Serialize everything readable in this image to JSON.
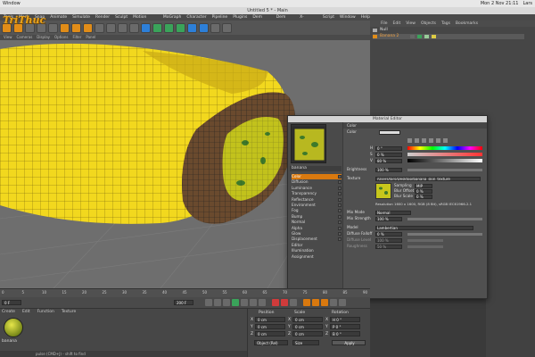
{
  "macbar": {
    "app": "Window",
    "clock": "Mon 2 Nov 21:11",
    "user": "Lars"
  },
  "window_title": "Untitled 5 * - Main",
  "menu": [
    "Tools",
    "Mesh",
    "Snap",
    "Animate",
    "Simulate",
    "Render",
    "Sculpt",
    "Motion Tracker",
    "MoGraph",
    "Character",
    "Pipeline",
    "Plugins",
    "Dem Earth",
    "Dem Earth",
    "X-Particles",
    "Script",
    "Window",
    "Help"
  ],
  "view_menu": [
    "View",
    "Cameras",
    "Display",
    "Options",
    "Filter",
    "Panel"
  ],
  "watermark": "TriThuc",
  "objects": {
    "menu": [
      "File",
      "Edit",
      "View",
      "Objects",
      "Tags",
      "Bookmarks"
    ],
    "rows": [
      {
        "name": "Null"
      },
      {
        "name": "Banana 2"
      }
    ]
  },
  "material_editor": {
    "title": "Material Editor",
    "material_name": "banana",
    "channels": [
      {
        "label": "Color",
        "selected": true
      },
      {
        "label": "Diffusion"
      },
      {
        "label": "Luminance"
      },
      {
        "label": "Transparency"
      },
      {
        "label": "Reflectance"
      },
      {
        "label": "Environment"
      },
      {
        "label": "Fog"
      },
      {
        "label": "Bump"
      },
      {
        "label": "Normal"
      },
      {
        "label": "Alpha"
      },
      {
        "label": "Glow"
      },
      {
        "label": "Displacement"
      },
      {
        "label": "Editor"
      },
      {
        "label": "Illumination"
      },
      {
        "label": "Assignment"
      }
    ],
    "section": "Color",
    "color_label": "Color",
    "h_label": "H",
    "h_value": "0 °",
    "s_label": "S",
    "s_value": "0 %",
    "v_label": "V",
    "v_value": "80 %",
    "brightness_label": "Brightness",
    "brightness_value": "100 %",
    "texture_label": "Texture",
    "texture_path": "/Users/lars/Desktop/banana_skin_texture",
    "sampling_label": "Sampling",
    "sampling_value": "MIP",
    "blur_offset_label": "Blur Offset",
    "blur_offset_value": "0 %",
    "blur_scale_label": "Blur Scale",
    "blur_scale_value": "0 %",
    "resolution": "Resolution 1600 x 1600, RGB (8 Bit), sRGB IEC61966-2.1",
    "mix_mode_label": "Mix Mode",
    "mix_mode_value": "Normal",
    "mix_strength_label": "Mix Strength",
    "mix_strength_value": "100 %",
    "model_label": "Model",
    "model_value": "Lambertian",
    "diffuse_falloff_label": "Diffuse Falloff",
    "diffuse_falloff_value": "0 %",
    "diffuse_level_label": "Diffuse Level",
    "diffuse_level_value": "100 %",
    "roughness_label": "Roughness",
    "roughness_value": "50 %"
  },
  "timeline": {
    "ticks": [
      "0",
      "5",
      "10",
      "15",
      "20",
      "25",
      "30",
      "35",
      "40",
      "45",
      "50",
      "55",
      "60",
      "65",
      "70",
      "75",
      "80",
      "85",
      "90"
    ],
    "current": "0 F",
    "end": "200 F"
  },
  "material_manager": {
    "tabs": [
      "Create",
      "Edit",
      "Function",
      "Texture"
    ],
    "mat_label": "banana"
  },
  "coordinates": {
    "headers": [
      "Position",
      "Scale",
      "Rotation"
    ],
    "axes": [
      "X",
      "Y",
      "Z"
    ],
    "position": [
      "0 cm",
      "0 cm",
      "0 cm"
    ],
    "scale": [
      "0 cm",
      "0 cm",
      "0 cm"
    ],
    "rotation": [
      "H 0 °",
      "P 0 °",
      "B 0 °"
    ],
    "mode": "Object (Rel)",
    "size_mode": "Size",
    "apply": "Apply"
  },
  "status": "pulse (CMD+J) - shift to find",
  "colors": {
    "accent": "#d9790f",
    "banana": "#f2d81e",
    "viewport": "#6e6e6e"
  }
}
